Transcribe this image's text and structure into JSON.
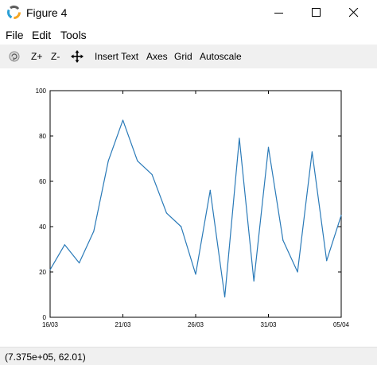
{
  "window": {
    "title": "Figure 4"
  },
  "menu": {
    "items": [
      "File",
      "Edit",
      "Tools"
    ]
  },
  "toolbar": {
    "zoom_in": "Z+",
    "zoom_out": "Z-",
    "insert_text": "Insert Text",
    "axes": "Axes",
    "grid": "Grid",
    "autoscale": "Autoscale"
  },
  "status": {
    "coords": "(7.375e+05, 62.01)"
  },
  "colors": {
    "line": "#2a7ab8",
    "toolbar_bg": "#f0f0f0"
  },
  "chart_data": {
    "type": "line",
    "title": "",
    "xlabel": "",
    "ylabel": "",
    "ylim": [
      0,
      100
    ],
    "xlim": [
      "16/03",
      "05/04"
    ],
    "yticks": [
      "0",
      "20",
      "40",
      "60",
      "80",
      "100"
    ],
    "xticks": [
      "16/03",
      "21/03",
      "26/03",
      "31/03",
      "05/04"
    ],
    "grid": false,
    "series": [
      {
        "x": [
          "16/03",
          "17/03",
          "18/03",
          "19/03",
          "20/03",
          "21/03",
          "22/03",
          "23/03",
          "24/03",
          "25/03",
          "26/03",
          "27/03",
          "28/03",
          "29/03",
          "30/03",
          "31/03",
          "01/04",
          "02/04",
          "03/04",
          "04/04",
          "05/04"
        ],
        "values": [
          21,
          32,
          24,
          38,
          69,
          87,
          69,
          63,
          46,
          40,
          19,
          56,
          9,
          79,
          16,
          75,
          34,
          20,
          73,
          25,
          45
        ]
      }
    ]
  }
}
